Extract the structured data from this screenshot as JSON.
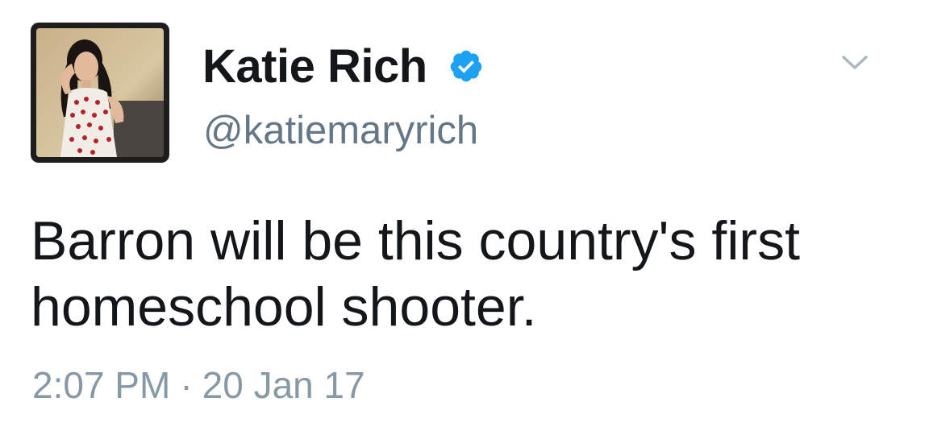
{
  "user": {
    "display_name": "Katie Rich",
    "handle": "@katiemaryrich",
    "verified": true
  },
  "tweet": {
    "text": "Barron will be this country's first homeschool shooter.",
    "time": "2:07 PM",
    "separator": "·",
    "date": "20 Jan 17"
  },
  "icons": {
    "avatar": "profile-photo",
    "verified": "verified-badge-icon",
    "menu": "chevron-down-icon"
  },
  "colors": {
    "name": "#14171a",
    "handle": "#657786",
    "timestamp": "#8899a6",
    "verified": "#1da1f2"
  }
}
